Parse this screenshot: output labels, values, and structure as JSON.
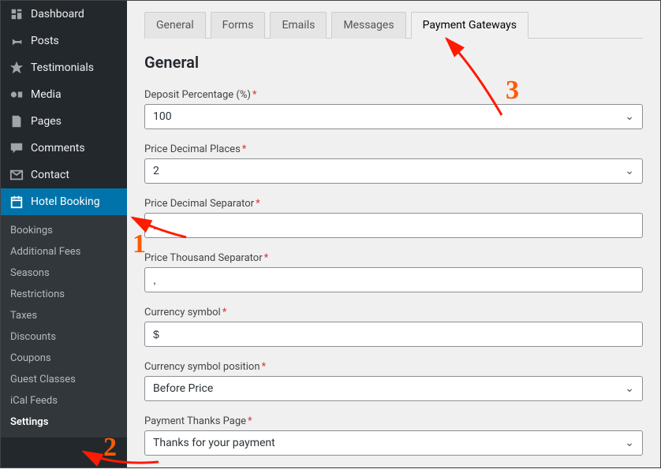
{
  "sidebar": {
    "items": [
      {
        "label": "Dashboard",
        "icon": "dashboard"
      },
      {
        "label": "Posts",
        "icon": "pin"
      },
      {
        "label": "Testimonials",
        "icon": "star"
      },
      {
        "label": "Media",
        "icon": "media"
      },
      {
        "label": "Pages",
        "icon": "page"
      },
      {
        "label": "Comments",
        "icon": "comment"
      },
      {
        "label": "Contact",
        "icon": "mail"
      },
      {
        "label": "Hotel Booking",
        "icon": "calendar"
      }
    ],
    "sub": [
      "Bookings",
      "Additional Fees",
      "Seasons",
      "Restrictions",
      "Taxes",
      "Discounts",
      "Coupons",
      "Guest Classes",
      "iCal Feeds",
      "Settings"
    ]
  },
  "tabs": {
    "items": [
      "General",
      "Forms",
      "Emails",
      "Messages",
      "Payment Gateways"
    ],
    "active": "Payment Gateways"
  },
  "section": {
    "title": "General"
  },
  "fields": {
    "deposit": {
      "label": "Deposit Percentage (%)",
      "value": "100",
      "type": "select"
    },
    "decimals": {
      "label": "Price Decimal Places",
      "value": "2",
      "type": "select"
    },
    "decsep": {
      "label": "Price Decimal Separator",
      "value": ".",
      "type": "text"
    },
    "thousep": {
      "label": "Price Thousand Separator",
      "value": ",",
      "type": "text"
    },
    "cursym": {
      "label": "Currency symbol",
      "value": "$",
      "type": "text"
    },
    "curpos": {
      "label": "Currency symbol position",
      "value": "Before Price",
      "type": "select"
    },
    "thanks": {
      "label": "Payment Thanks Page",
      "value": "Thanks for your payment",
      "type": "select"
    }
  },
  "annotations": {
    "n1": "1",
    "n2": "2",
    "n3": "3"
  }
}
